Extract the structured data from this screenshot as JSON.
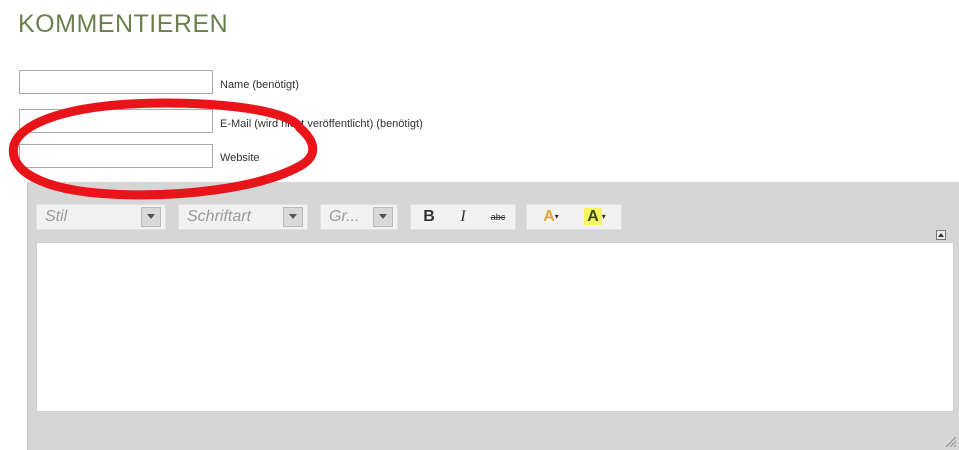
{
  "form": {
    "title": "KOMMENTIEREN",
    "fields": [
      {
        "label": "Name (benötigt)",
        "value": ""
      },
      {
        "label": "E-Mail (wird nicht veröffentlicht) (benötigt)",
        "value": ""
      },
      {
        "label": "Website",
        "value": ""
      }
    ]
  },
  "editor": {
    "style_combo": "Stil",
    "font_combo": "Schriftart",
    "size_combo": "Gr...",
    "bold": "B",
    "italic": "I",
    "strike": "abc",
    "text_color_glyph": "A",
    "bg_color_glyph": "A",
    "text_color": "#e8a33c",
    "bg_highlight": "#f5f560"
  },
  "annotation": {
    "color": "#e8141a"
  }
}
